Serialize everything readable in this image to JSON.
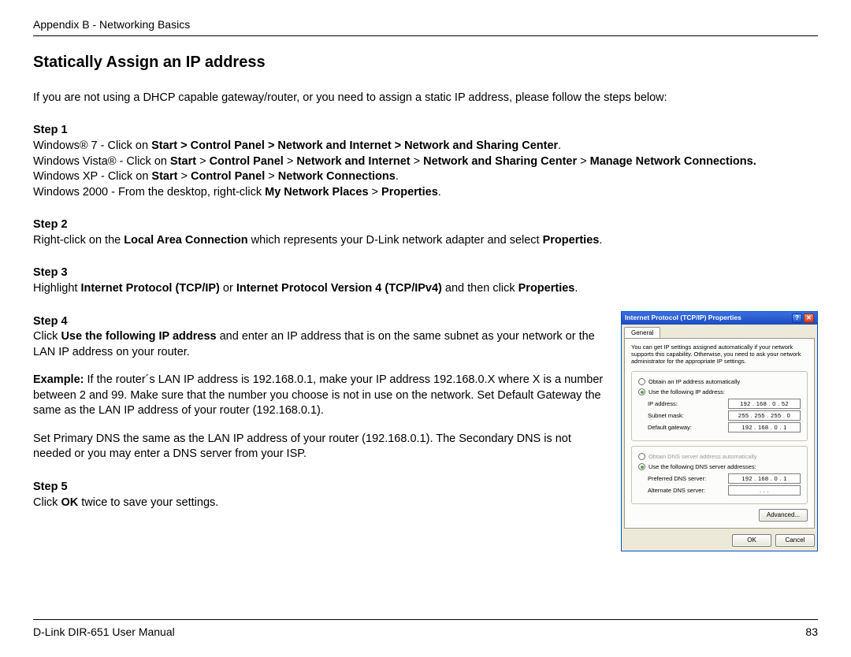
{
  "header": {
    "breadcrumb": "Appendix B - Networking Basics"
  },
  "title": "Statically Assign an IP address",
  "intro": "If you are not using a DHCP capable gateway/router, or you need to assign a static IP address, please follow the steps below:",
  "steps": {
    "s1": {
      "label": "Step 1",
      "win7_a": "Windows® 7 - Click on ",
      "win7_b": "Start > Control Panel > Network and Internet > Network and Sharing Center",
      "win7_c": ".",
      "vista_a": "Windows Vista® - Click on ",
      "vista_b1": "Start",
      "vista_b2": " > ",
      "vista_b3": "Control Panel",
      "vista_b4": " > ",
      "vista_b5": "Network and Internet",
      "vista_b6": " > ",
      "vista_b7": "Network and Sharing Center",
      "vista_b8": " > ",
      "vista_b9": "Manage Network Connections.",
      "xp_a": "Windows XP - Click on ",
      "xp_b1": "Start",
      "xp_b2": " > ",
      "xp_b3": "Control Panel",
      "xp_b4": " > ",
      "xp_b5": "Network Connections",
      "xp_c": ".",
      "w2000_a": "Windows 2000 - From the desktop, right-click ",
      "w2000_b1": "My Network Places",
      "w2000_b2": " > ",
      "w2000_b3": "Properties",
      "w2000_c": "."
    },
    "s2": {
      "label": "Step 2",
      "a": "Right-click on the ",
      "b": "Local Area Connection",
      "c": " which represents your D-Link network adapter and select ",
      "d": "Properties",
      "e": "."
    },
    "s3": {
      "label": "Step 3",
      "a": "Highlight ",
      "b": "Internet Protocol (TCP/IP)",
      "c": " or ",
      "d": "Internet Protocol Version 4 (TCP/IPv4)",
      "e": " and then click ",
      "f": "Properties",
      "g": "."
    },
    "s4": {
      "label": "Step 4",
      "a": "Click ",
      "b": "Use the following IP address",
      "c": " and enter an IP address that is on the same subnet as your network or the LAN IP address on your router.",
      "ex_a": "Example:",
      "ex_b": " If the router´s LAN IP address is 192.168.0.1, make your IP address 192.168.0.X where X is a number between 2 and 99. Make sure that the number you choose is not in use on the network. Set Default Gateway the same as the LAN IP address of your router (192.168.0.1).",
      "dns": "Set Primary DNS the same as the LAN IP address of your router (192.168.0.1). The Secondary DNS is not needed or you may enter a DNS server from your ISP."
    },
    "s5": {
      "label": "Step 5",
      "a": "Click ",
      "b": "OK",
      "c": " twice to save your settings."
    }
  },
  "dialog": {
    "title": "Internet Protocol (TCP/IP) Properties",
    "tab": "General",
    "desc": "You can get IP settings assigned automatically if your network supports this capability. Otherwise, you need to ask your network administrator for the appropriate IP settings.",
    "radio_auto_ip": "Obtain an IP address automatically",
    "radio_use_ip": "Use the following IP address:",
    "ip_label": "IP address:",
    "ip_value": "192 . 168 .  0  .  52",
    "mask_label": "Subnet mask:",
    "mask_value": "255 . 255 . 255 .  0",
    "gw_label": "Default gateway:",
    "gw_value": "192 . 168 .  0  .   1",
    "radio_auto_dns": "Obtain DNS server address automatically",
    "radio_use_dns": "Use the following DNS server addresses:",
    "pdns_label": "Preferred DNS server:",
    "pdns_value": "192 . 168 .  0  .   1",
    "adns_label": "Alternate DNS server:",
    "adns_value": " .       .       .",
    "advanced": "Advanced...",
    "ok": "OK",
    "cancel": "Cancel",
    "help_glyph": "?",
    "close_glyph": "✕"
  },
  "footer": {
    "manual": "D-Link DIR-651 User Manual",
    "page": "83"
  }
}
